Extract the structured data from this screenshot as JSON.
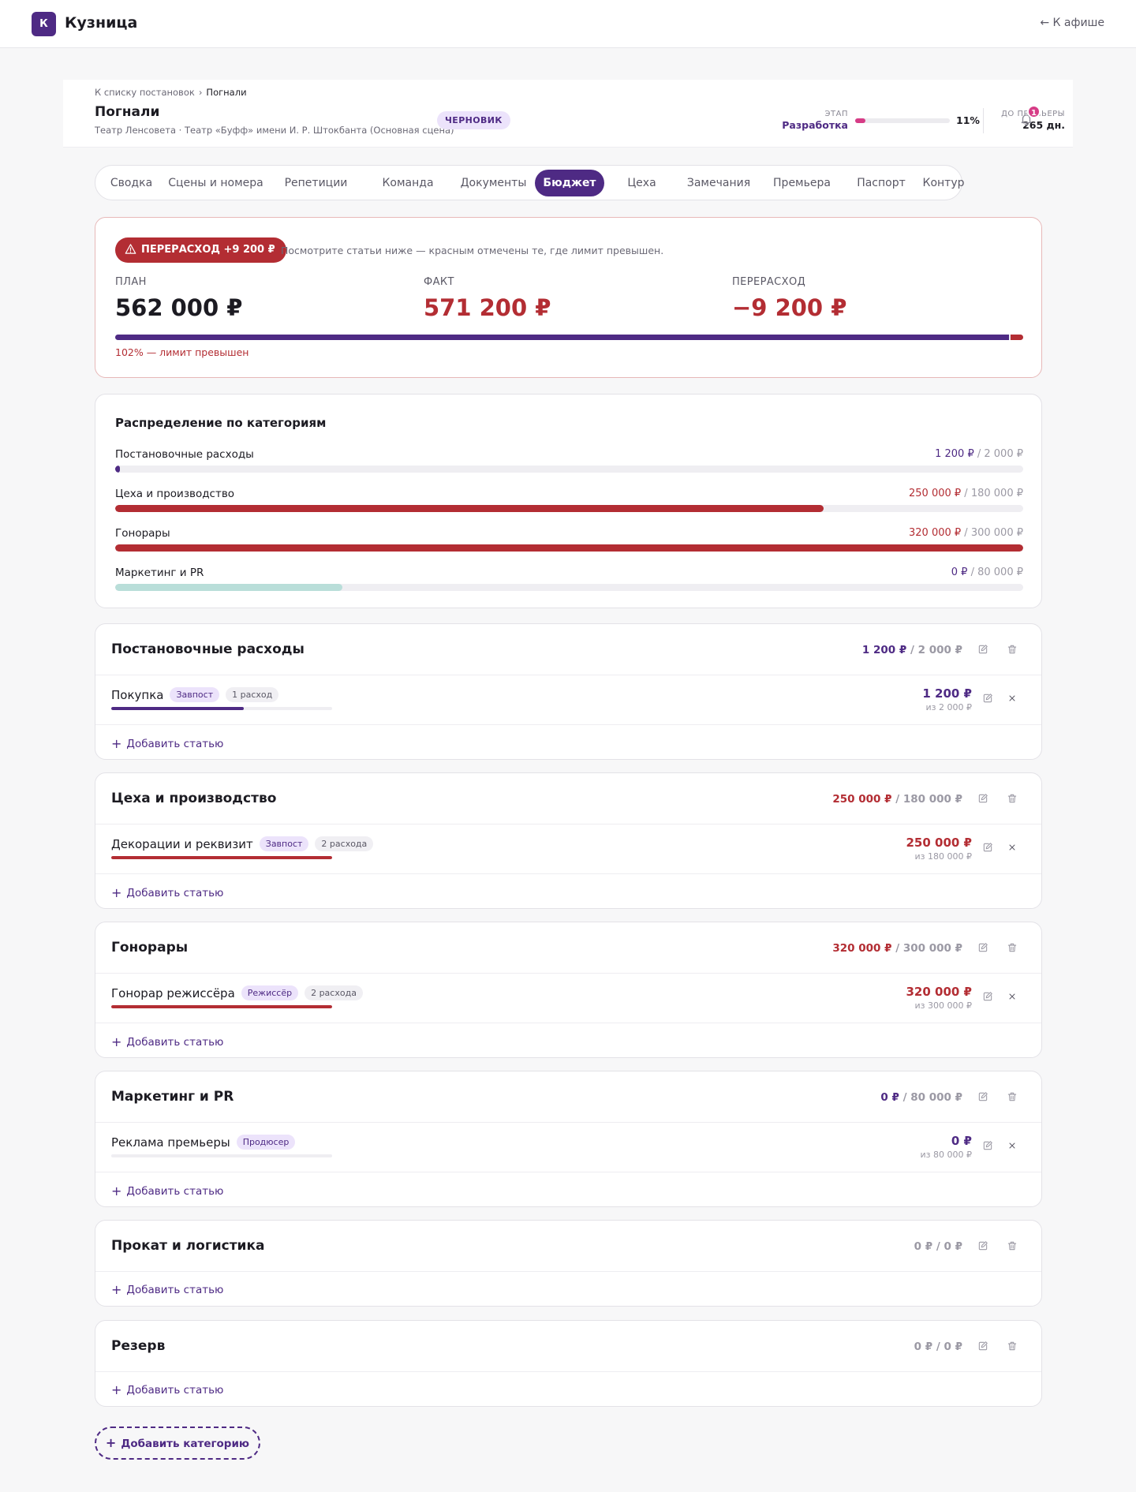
{
  "topbar": {
    "logo_letter": "К",
    "brand": "Кузница",
    "back": "← К афише"
  },
  "header": {
    "crumb_back": "К списку постановок",
    "crumb_sep": "›",
    "crumb_current": "Погнали",
    "title": "Погнали",
    "subtitle": "Театр Ленсовета · Театр «Буфф» имени И. Р. Штокбанта (Основная сцена)",
    "status_badge": "ЧЕРНОВИК",
    "stage_label": "ЭТАП",
    "stage_value": "Разработка",
    "stage_progress": 0.11,
    "stage_pct": "11%",
    "premiere_label": "ДО ПРЕМЬЕРЫ",
    "premiere_value": "265 дн.",
    "notifications": "1"
  },
  "tabs": [
    {
      "label": "Сводка"
    },
    {
      "label": "Сцены и номера"
    },
    {
      "label": "Репетиции"
    },
    {
      "label": "Команда"
    },
    {
      "label": "Документы"
    },
    {
      "label": "Бюджет",
      "active": true
    },
    {
      "label": "Цеха"
    },
    {
      "label": "Замечания"
    },
    {
      "label": "Премьера"
    },
    {
      "label": "Паспорт"
    },
    {
      "label": "Контур"
    }
  ],
  "summary": {
    "overrun_pill": "ПЕРЕРАСХОД +9 200 ₽",
    "hint": "Посмотрите статьи ниже — красным отмечены те, где лимит превышен.",
    "plan_label": "ПЛАН",
    "plan_value": "562 000 ₽",
    "fact_label": "ФАКТ",
    "fact_value": "571 200 ₽",
    "over_label": "ПЕРЕРАСХОД",
    "over_value": "−9 200 ₽",
    "plan_share": 0.984,
    "usage_note": "102% — лимит превышен"
  },
  "distribution": {
    "title": "Распределение по категориям",
    "rows": [
      {
        "name": "Постановочные расходы",
        "spent": "1 200 ₽",
        "sep": " / ",
        "limit": "2 000 ₽",
        "ratio": 0.005,
        "over": false,
        "color": "#4e2a84"
      },
      {
        "name": "Цеха и производство",
        "spent": "250 000 ₽",
        "sep": " / ",
        "limit": "180 000 ₽",
        "ratio": 0.78,
        "over": true,
        "color": "#b32d33"
      },
      {
        "name": "Гонорары",
        "spent": "320 000 ₽",
        "sep": " / ",
        "limit": "300 000 ₽",
        "ratio": 1.0,
        "over": true,
        "color": "#b32d33"
      },
      {
        "name": "Маркетинг и PR",
        "spent": "0 ₽",
        "sep": " / ",
        "limit": "80 000 ₽",
        "ratio": 0.25,
        "over": false,
        "color": "#b9ded9"
      }
    ]
  },
  "categories": [
    {
      "title": "Постановочные расходы",
      "spent": "1 200 ₽",
      "sep": " / ",
      "limit": "2 000 ₽",
      "state": "ok",
      "item": {
        "name": "Покупка",
        "tag": "Завпост",
        "count": "1 расход",
        "amount": "1 200 ₽",
        "of": "из 2 000 ₽",
        "ratio": 0.6,
        "over": false
      }
    },
    {
      "title": "Цеха и производство",
      "spent": "250 000 ₽",
      "sep": " / ",
      "limit": "180 000 ₽",
      "state": "over",
      "item": {
        "name": "Декорации и реквизит",
        "tag": "Завпост",
        "count": "2 расхода",
        "amount": "250 000 ₽",
        "of": "из 180 000 ₽",
        "ratio": 1.0,
        "over": true
      }
    },
    {
      "title": "Гонорары",
      "spent": "320 000 ₽",
      "sep": " / ",
      "limit": "300 000 ₽",
      "state": "over",
      "item": {
        "name": "Гонорар режиссёра",
        "tag": "Режиссёр",
        "count": "2 расхода",
        "amount": "320 000 ₽",
        "of": "из 300 000 ₽",
        "ratio": 1.0,
        "over": true
      }
    },
    {
      "title": "Маркетинг и PR",
      "spent": "0 ₽",
      "sep": " / ",
      "limit": "80 000 ₽",
      "state": "ok",
      "item": {
        "name": "Реклама премьеры",
        "tag": "Продюсер",
        "count": "",
        "amount": "0 ₽",
        "of": "из 80 000 ₽",
        "ratio": 0.0,
        "over": false
      }
    },
    {
      "title": "Прокат и логистика",
      "spent": "0 ₽",
      "sep": " / ",
      "limit": "0 ₽",
      "state": "zero",
      "item": null
    },
    {
      "title": "Резерв",
      "spent": "0 ₽",
      "sep": " / ",
      "limit": "0 ₽",
      "state": "zero",
      "item": null
    }
  ],
  "add_item_label": "Добавить статью",
  "add_category_label": "Добавить категорию",
  "colors": {
    "accent": "#4e2a84",
    "danger": "#b32d33",
    "pink": "#d63c86"
  },
  "icons": {
    "edit": "edit-icon",
    "delete": "trash-icon",
    "remove": "close-icon",
    "alert": "warning-icon",
    "bell": "bell-icon"
  }
}
